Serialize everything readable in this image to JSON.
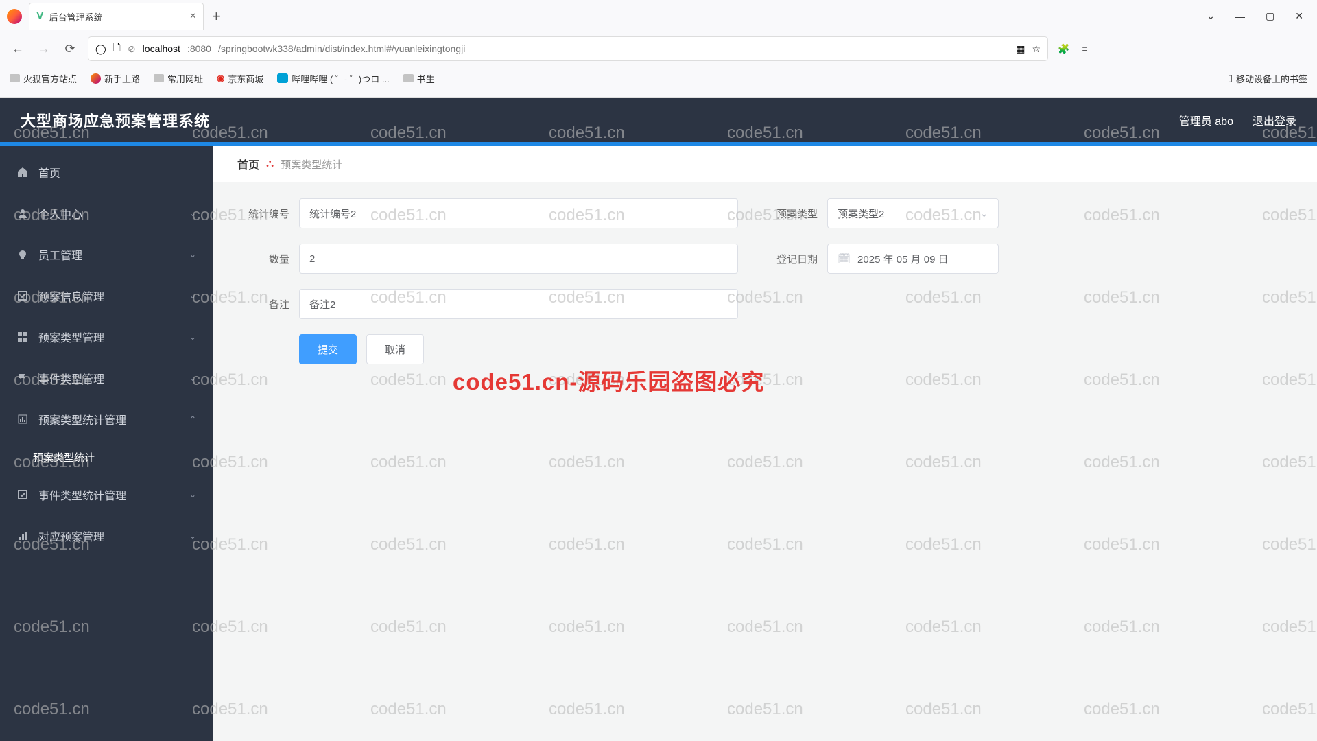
{
  "browser": {
    "tab_title": "后台管理系统",
    "url_host": "localhost",
    "url_port": ":8080",
    "url_path": "/springbootwk338/admin/dist/index.html#/yuanleixingtongji",
    "bookmarks": [
      "火狐官方站点",
      "新手上路",
      "常用网址",
      "京东商城",
      "哔哩哔哩 ( ゜- ゜)つロ ...",
      "书生"
    ],
    "mobile_bookmark": "移动设备上的书签"
  },
  "app": {
    "title": "大型商场应急预案管理系统",
    "admin_label": "管理员 abo",
    "logout": "退出登录",
    "sidebar": [
      {
        "icon": "home",
        "label": "首页",
        "expandable": false
      },
      {
        "icon": "user",
        "label": "个人中心",
        "expandable": true
      },
      {
        "icon": "bulb",
        "label": "员工管理",
        "expandable": true
      },
      {
        "icon": "check",
        "label": "预案信息管理",
        "expandable": true
      },
      {
        "icon": "grid",
        "label": "预案类型管理",
        "expandable": true
      },
      {
        "icon": "flag",
        "label": "事件类型管理",
        "expandable": true
      },
      {
        "icon": "chart",
        "label": "预案类型统计管理",
        "expandable": true,
        "open": true,
        "children": [
          "预案类型统计"
        ]
      },
      {
        "icon": "check",
        "label": "事件类型统计管理",
        "expandable": true
      },
      {
        "icon": "bars",
        "label": "对应预案管理",
        "expandable": true
      }
    ],
    "breadcrumb": {
      "home": "首页",
      "current": "预案类型统计"
    },
    "form": {
      "labels": {
        "stat_no": "统计编号",
        "plan_type": "预案类型",
        "qty": "数量",
        "reg_date": "登记日期",
        "remark": "备注"
      },
      "values": {
        "stat_no": "统计编号2",
        "plan_type": "预案类型2",
        "qty": "2",
        "reg_date": "2025 年 05 月 09 日",
        "remark": "备注2"
      },
      "buttons": {
        "submit": "提交",
        "cancel": "取消"
      }
    }
  },
  "watermark_text": "code51.cn",
  "big_watermark": "code51.cn-源码乐园盗图必究"
}
